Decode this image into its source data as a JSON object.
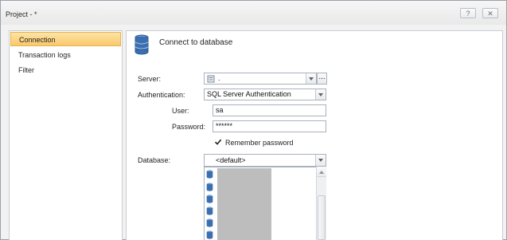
{
  "window": {
    "title": "Project - *",
    "help_label": "?",
    "close_label": "✕"
  },
  "sidebar": {
    "items": [
      {
        "label": "Connection",
        "active": true
      },
      {
        "label": "Transaction logs",
        "active": false
      },
      {
        "label": "Filter",
        "active": false
      }
    ]
  },
  "main": {
    "header": "Connect to database",
    "server": {
      "label": "Server:",
      "value": ".",
      "browse_label": "..."
    },
    "authentication": {
      "label": "Authentication:",
      "value": "SQL Server Authentication"
    },
    "user": {
      "label": "User:",
      "value": "sa"
    },
    "password": {
      "label": "Password:",
      "value": "******"
    },
    "remember": {
      "label": "Remember password",
      "checked": true
    },
    "database": {
      "label": "Database:",
      "value": "<default>",
      "list_items": [
        "",
        "",
        "",
        "",
        "",
        "",
        ""
      ]
    }
  },
  "colors": {
    "accent": "#f9c86a",
    "db_icon": "#3d6fb0"
  },
  "icons": {
    "header": "database-icon",
    "server": "server-icon",
    "list": "database-icon"
  }
}
